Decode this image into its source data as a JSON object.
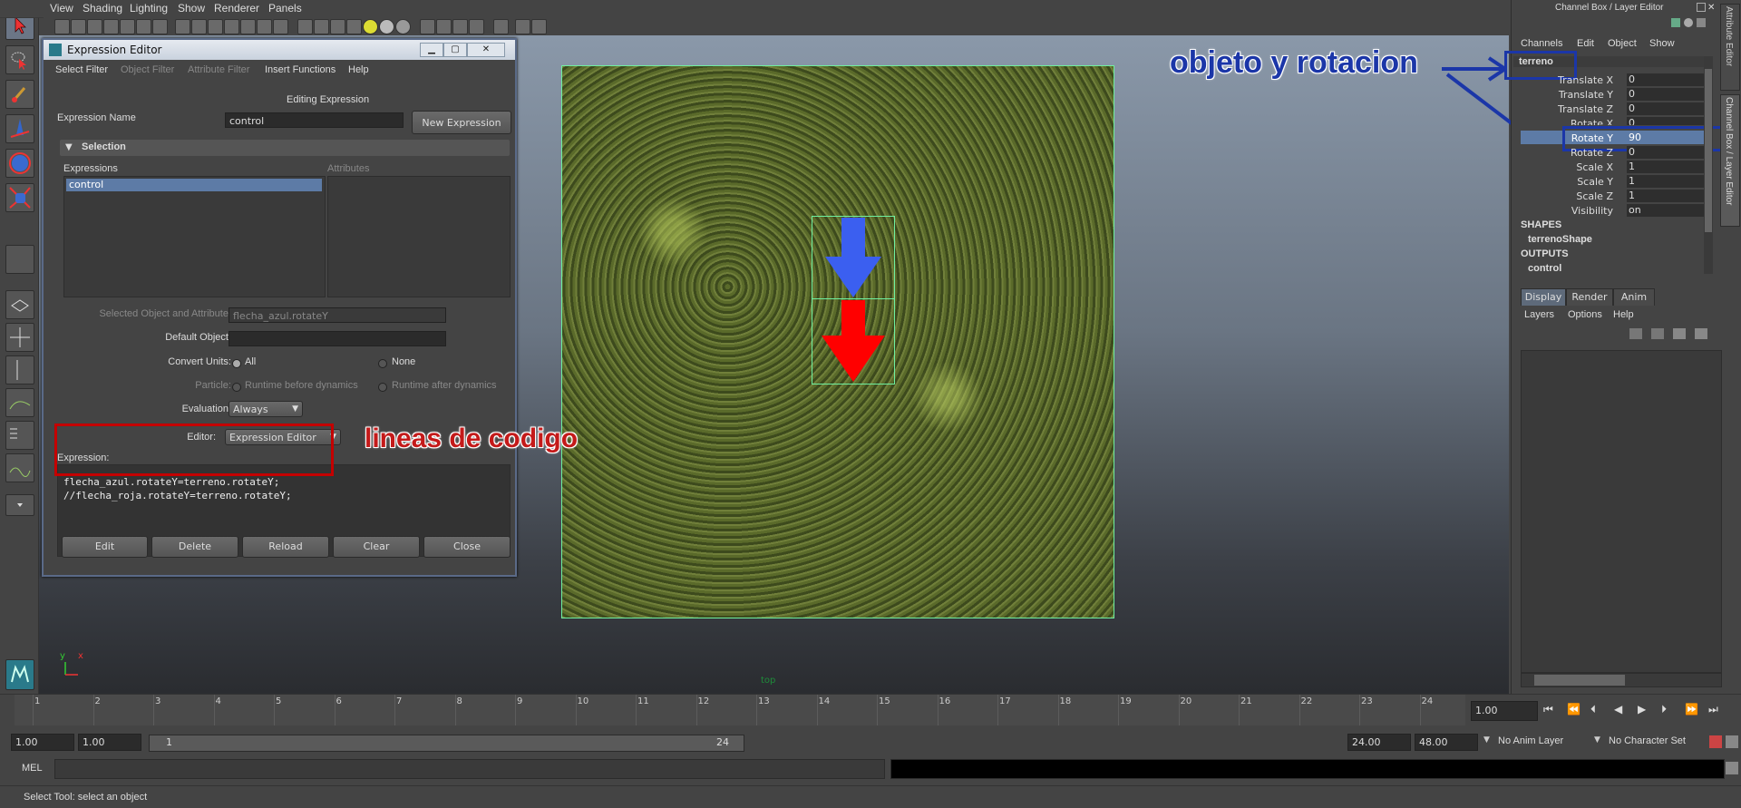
{
  "menubar": {
    "items": [
      "View",
      "Shading",
      "Lighting",
      "Show",
      "Renderer",
      "Panels"
    ]
  },
  "viewport": {
    "camera_label": "top",
    "axis_y": "y",
    "axis_x": "x"
  },
  "expression_editor": {
    "title": "Expression Editor",
    "menu": [
      "Select Filter",
      "Object Filter",
      "Attribute Filter",
      "Insert Functions",
      "Help"
    ],
    "heading": "Editing Expression",
    "expression_name_label": "Expression Name",
    "expression_name_value": "control",
    "new_expression_label": "New Expression",
    "selection_label": "Selection",
    "expressions_header": "Expressions",
    "attributes_header": "Attributes",
    "expressions_list": [
      "control"
    ],
    "selected_obj_label": "Selected Object and Attribute:",
    "selected_obj_value": "flecha_azul.rotateY",
    "default_object_label": "Default Object:",
    "default_object_value": "",
    "convert_units_label": "Convert Units:",
    "convert_all": "All",
    "convert_none": "None",
    "particle_label": "Particle:",
    "runtime_before": "Runtime before dynamics",
    "runtime_after": "Runtime after dynamics",
    "evaluation_label": "Evaluation:",
    "evaluation_value": "Always",
    "editor_label": "Editor:",
    "editor_value": "Expression Editor",
    "expression_label": "Expression:",
    "code_line_1": "flecha_azul.rotateY=terreno.rotateY;",
    "code_line_2": "//flecha_roja.rotateY=terreno.rotateY;",
    "buttons": [
      "Edit",
      "Delete",
      "Reload",
      "Clear",
      "Close"
    ]
  },
  "annotations": {
    "code_note": "lineas de codigo",
    "object_note": "objeto y rotacion"
  },
  "channel_box": {
    "title": "Channel Box / Layer Editor",
    "menu": [
      "Channels",
      "Edit",
      "Object",
      "Show"
    ],
    "object_name": "terreno",
    "channels": [
      {
        "label": "Translate X",
        "value": "0"
      },
      {
        "label": "Translate Y",
        "value": "0"
      },
      {
        "label": "Translate Z",
        "value": "0"
      },
      {
        "label": "Rotate X",
        "value": "0"
      },
      {
        "label": "Rotate Y",
        "value": "90"
      },
      {
        "label": "Rotate Z",
        "value": "0"
      },
      {
        "label": "Scale X",
        "value": "1"
      },
      {
        "label": "Scale Y",
        "value": "1"
      },
      {
        "label": "Scale Z",
        "value": "1"
      },
      {
        "label": "Visibility",
        "value": "on"
      }
    ],
    "shapes_label": "SHAPES",
    "shape_name": "terrenoShape",
    "outputs_label": "OUTPUTS",
    "output_name": "control",
    "side_tab_1": "Attribute Editor",
    "side_tab_2": "Channel Box / Layer Editor",
    "layer_tabs": [
      "Display",
      "Render",
      "Anim"
    ],
    "layer_menu": [
      "Layers",
      "Options",
      "Help"
    ]
  },
  "timeline": {
    "frames": [
      "1",
      "2",
      "3",
      "4",
      "5",
      "6",
      "7",
      "8",
      "9",
      "10",
      "11",
      "12",
      "13",
      "14",
      "15",
      "16",
      "17",
      "18",
      "19",
      "20",
      "21",
      "22",
      "23",
      "24"
    ],
    "current_frame": "1.00"
  },
  "range": {
    "start_time": "1.00",
    "start_playback": "1.00",
    "slider_start": "1",
    "slider_end": "24",
    "end_playback": "24.00",
    "end_time": "48.00",
    "anim_layer": "No Anim Layer",
    "character_set": "No Character Set"
  },
  "command_line": {
    "label": "MEL"
  },
  "help_line": {
    "text": "Select Tool: select an object"
  },
  "colors": {
    "arrow_blue": "#3b5ff0",
    "arrow_red": "#ff0000",
    "annotation_red": "#c40000",
    "annotation_blue": "#1b36a8",
    "selection_blue": "#5d7ba6"
  }
}
